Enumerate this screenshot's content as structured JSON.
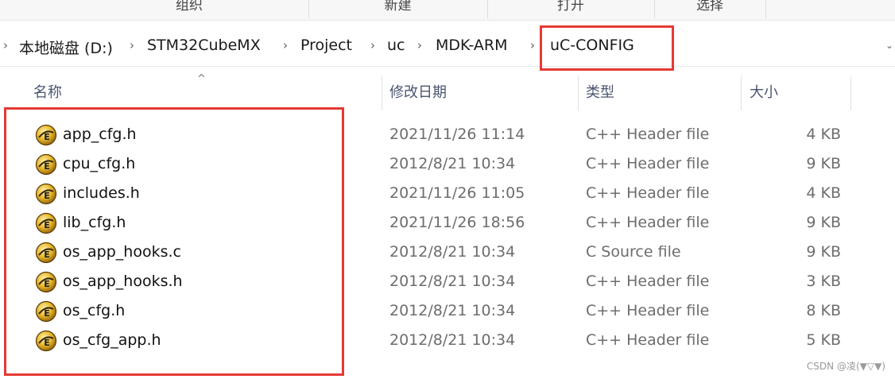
{
  "ribbon": {
    "groups": [
      "组织",
      "新建",
      "打开",
      "选择"
    ]
  },
  "breadcrumb": {
    "items": [
      "本地磁盘 (D:)",
      "STM32CubeMX",
      "Project",
      "uc",
      "MDK-ARM",
      "uC-CONFIG"
    ],
    "separator": "›",
    "leading_chevron": "›",
    "dropdown": "⌄"
  },
  "columns": {
    "name": "名称",
    "date": "修改日期",
    "type": "类型",
    "size": "大小",
    "sort_indicator": "^"
  },
  "files": [
    {
      "name": "app_cfg.h",
      "date": "2021/11/26 11:14",
      "type": "C++ Header file",
      "size": "4 KB"
    },
    {
      "name": "cpu_cfg.h",
      "date": "2012/8/21 10:34",
      "type": "C++ Header file",
      "size": "9 KB"
    },
    {
      "name": "includes.h",
      "date": "2021/11/26 11:05",
      "type": "C++ Header file",
      "size": "4 KB"
    },
    {
      "name": "lib_cfg.h",
      "date": "2021/11/26 18:56",
      "type": "C++ Header file",
      "size": "9 KB"
    },
    {
      "name": "os_app_hooks.c",
      "date": "2012/8/21 10:34",
      "type": "C Source file",
      "size": "9 KB"
    },
    {
      "name": "os_app_hooks.h",
      "date": "2012/8/21 10:34",
      "type": "C++ Header file",
      "size": "3 KB"
    },
    {
      "name": "os_cfg.h",
      "date": "2012/8/21 10:34",
      "type": "C++ Header file",
      "size": "8 KB"
    },
    {
      "name": "os_cfg_app.h",
      "date": "2012/8/21 10:34",
      "type": "C++ Header file",
      "size": "5 KB"
    }
  ],
  "icons": {
    "file_icon": "uvision-file-icon"
  },
  "colors": {
    "highlight": "#e53935",
    "header_text": "#4a5670",
    "detail_text": "#6d6d6d",
    "icon_gold": "#d9a520"
  },
  "watermark": "CSDN @凌(▼▽▼)"
}
